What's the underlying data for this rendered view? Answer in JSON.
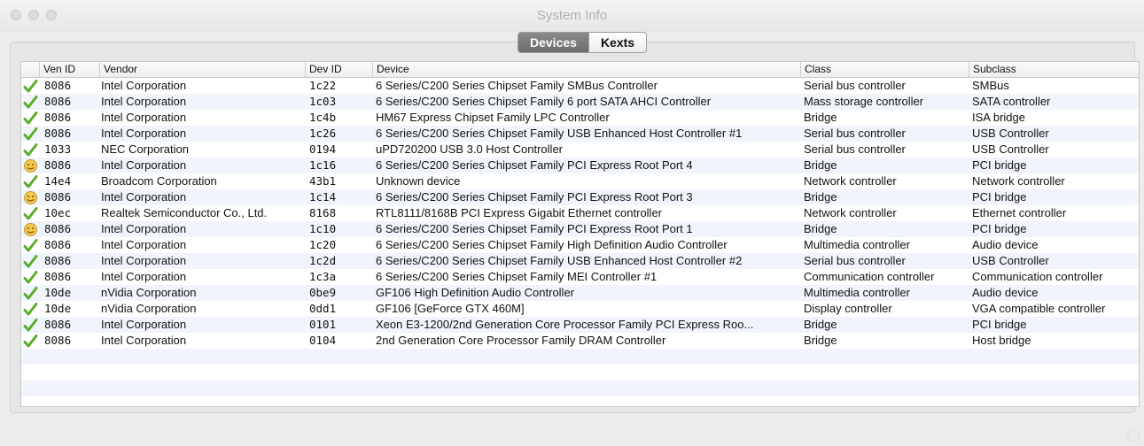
{
  "window": {
    "title": "System Info"
  },
  "tabs": [
    {
      "label": "Devices",
      "active": true
    },
    {
      "label": "Kexts",
      "active": false
    }
  ],
  "columns": [
    "Ven ID",
    "Vendor",
    "Dev ID",
    "Device",
    "Class",
    "Subclass"
  ],
  "status_icons": {
    "ok": "check-mark-icon",
    "warn": "smiley-face-icon"
  },
  "colors": {
    "check": "#5aad2b",
    "warn": "#f2c94c",
    "alt_row": "#f1f5fb"
  },
  "rows": [
    {
      "status": "ok",
      "ven": "8086",
      "vendor": "Intel Corporation",
      "dev": "1c22",
      "device": "6 Series/C200 Series Chipset Family SMBus Controller",
      "class": "Serial bus controller",
      "subclass": "SMBus"
    },
    {
      "status": "ok",
      "ven": "8086",
      "vendor": "Intel Corporation",
      "dev": "1c03",
      "device": "6 Series/C200 Series Chipset Family 6 port SATA AHCI Controller",
      "class": "Mass storage controller",
      "subclass": "SATA controller"
    },
    {
      "status": "ok",
      "ven": "8086",
      "vendor": "Intel Corporation",
      "dev": "1c4b",
      "device": "HM67 Express Chipset Family LPC Controller",
      "class": "Bridge",
      "subclass": "ISA bridge"
    },
    {
      "status": "ok",
      "ven": "8086",
      "vendor": "Intel Corporation",
      "dev": "1c26",
      "device": "6 Series/C200 Series Chipset Family USB Enhanced Host Controller #1",
      "class": "Serial bus controller",
      "subclass": "USB Controller"
    },
    {
      "status": "ok",
      "ven": "1033",
      "vendor": "NEC Corporation",
      "dev": "0194",
      "device": "uPD720200 USB 3.0 Host Controller",
      "class": "Serial bus controller",
      "subclass": "USB Controller"
    },
    {
      "status": "warn",
      "ven": "8086",
      "vendor": "Intel Corporation",
      "dev": "1c16",
      "device": "6 Series/C200 Series Chipset Family PCI Express Root Port 4",
      "class": "Bridge",
      "subclass": "PCI bridge"
    },
    {
      "status": "ok",
      "ven": "14e4",
      "vendor": "Broadcom Corporation",
      "dev": "43b1",
      "device": "Unknown device",
      "class": "Network controller",
      "subclass": "Network controller"
    },
    {
      "status": "warn",
      "ven": "8086",
      "vendor": "Intel Corporation",
      "dev": "1c14",
      "device": "6 Series/C200 Series Chipset Family PCI Express Root Port 3",
      "class": "Bridge",
      "subclass": "PCI bridge"
    },
    {
      "status": "ok",
      "ven": "10ec",
      "vendor": "Realtek Semiconductor Co., Ltd.",
      "dev": "8168",
      "device": "RTL8111/8168B PCI Express Gigabit Ethernet controller",
      "class": "Network controller",
      "subclass": "Ethernet controller"
    },
    {
      "status": "warn",
      "ven": "8086",
      "vendor": "Intel Corporation",
      "dev": "1c10",
      "device": "6 Series/C200 Series Chipset Family PCI Express Root Port 1",
      "class": "Bridge",
      "subclass": "PCI bridge"
    },
    {
      "status": "ok",
      "ven": "8086",
      "vendor": "Intel Corporation",
      "dev": "1c20",
      "device": "6 Series/C200 Series Chipset Family High Definition Audio Controller",
      "class": "Multimedia controller",
      "subclass": "Audio device"
    },
    {
      "status": "ok",
      "ven": "8086",
      "vendor": "Intel Corporation",
      "dev": "1c2d",
      "device": "6 Series/C200 Series Chipset Family USB Enhanced Host Controller #2",
      "class": "Serial bus controller",
      "subclass": "USB Controller"
    },
    {
      "status": "ok",
      "ven": "8086",
      "vendor": "Intel Corporation",
      "dev": "1c3a",
      "device": "6 Series/C200 Series Chipset Family MEI Controller #1",
      "class": "Communication controller",
      "subclass": "Communication controller"
    },
    {
      "status": "ok",
      "ven": "10de",
      "vendor": "nVidia Corporation",
      "dev": "0be9",
      "device": "GF106 High Definition Audio Controller",
      "class": "Multimedia controller",
      "subclass": "Audio device"
    },
    {
      "status": "ok",
      "ven": "10de",
      "vendor": "nVidia Corporation",
      "dev": "0dd1",
      "device": "GF106 [GeForce GTX 460M]",
      "class": "Display controller",
      "subclass": "VGA compatible controller"
    },
    {
      "status": "ok",
      "ven": "8086",
      "vendor": "Intel Corporation",
      "dev": "0101",
      "device": "Xeon E3-1200/2nd Generation Core Processor Family PCI Express Roo...",
      "class": "Bridge",
      "subclass": "PCI bridge"
    },
    {
      "status": "ok",
      "ven": "8086",
      "vendor": "Intel Corporation",
      "dev": "0104",
      "device": "2nd Generation Core Processor Family DRAM Controller",
      "class": "Bridge",
      "subclass": "Host bridge"
    }
  ]
}
